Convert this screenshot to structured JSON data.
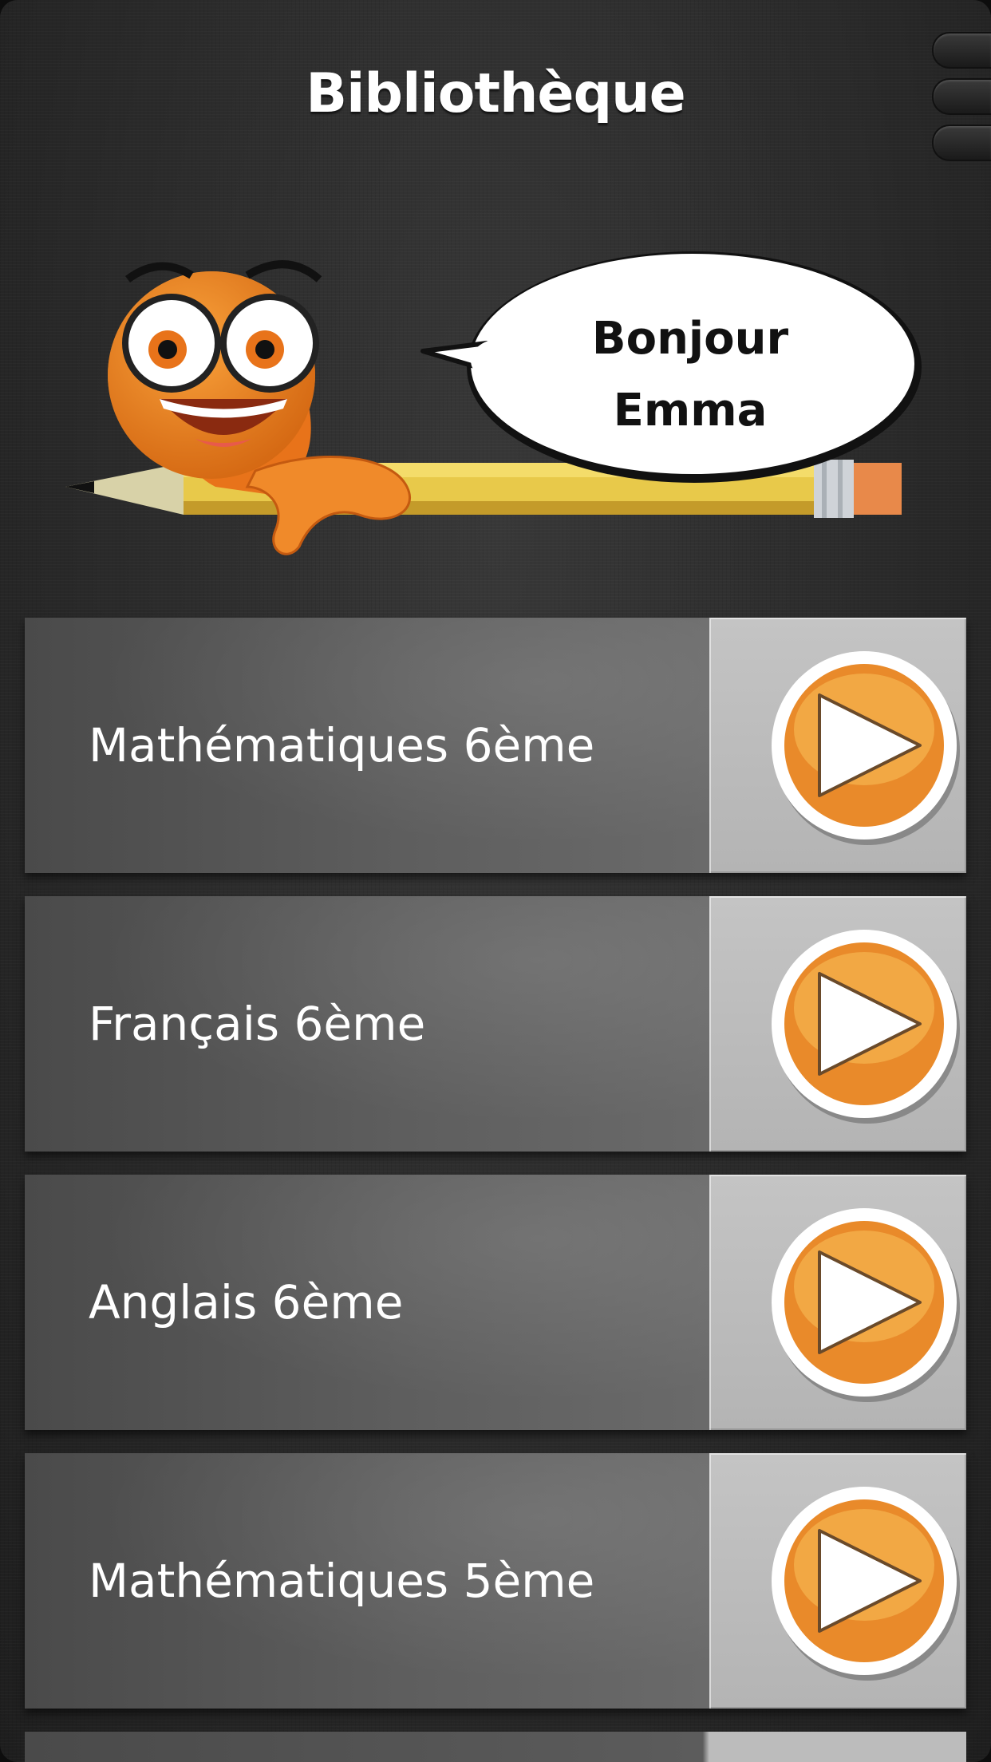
{
  "header": {
    "title": "Bibliothèque"
  },
  "greeting": {
    "line1": "Bonjour",
    "line2": "Emma"
  },
  "courses": [
    {
      "label": "Mathématiques 6ème"
    },
    {
      "label": "Français 6ème"
    },
    {
      "label": "Anglais 6ème"
    },
    {
      "label": "Mathématiques 5ème"
    }
  ],
  "icons": {
    "play": "play-icon",
    "menu": "menu-tab-icon",
    "mascot": "mascot-pencil-icon"
  },
  "colors": {
    "accent_orange": "#e98a2a",
    "background": "#2b2b2b",
    "row": "#575757",
    "play_panel": "#bdbdbd"
  }
}
